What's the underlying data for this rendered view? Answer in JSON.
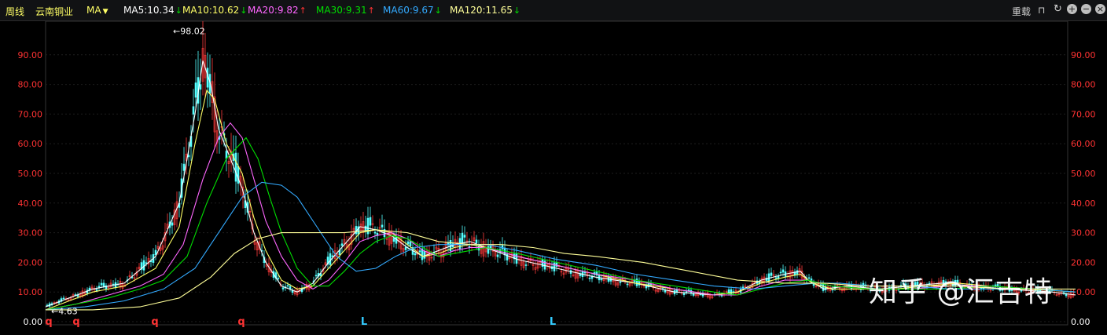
{
  "toolbar": {
    "period": "周线",
    "stock_name": "云南铜业",
    "indicator": "MA",
    "reload_label": "重载",
    "ma_items": [
      {
        "label": "MA5:10.34",
        "dir": "down",
        "color": "#ffffff"
      },
      {
        "label": "MA10:10.62",
        "dir": "down",
        "color": "#ffff66"
      },
      {
        "label": "MA20:9.82",
        "dir": "up",
        "color": "#ff66ff"
      },
      {
        "label": "MA30:9.31",
        "dir": "up",
        "color": "#00dd00"
      },
      {
        "label": "MA60:9.67",
        "dir": "down",
        "color": "#33aaff"
      },
      {
        "label": "MA120:11.65",
        "dir": "down",
        "color": "#ffff99"
      }
    ],
    "icons": [
      "lock-icon",
      "refresh-icon",
      "zoom-in-icon",
      "zoom-out-icon",
      "close-icon"
    ]
  },
  "watermark": "知乎 @汇吉特",
  "chart_data": {
    "type": "line",
    "ylim": [
      0,
      100
    ],
    "yticks": [
      "0.00",
      "10.00",
      "20.00",
      "30.00",
      "40.00",
      "50.00",
      "60.00",
      "70.00",
      "80.00",
      "90.00"
    ],
    "high_label": "←98.02",
    "low_label": "←4.63",
    "high": 98.02,
    "low": 4.63,
    "markers": [
      {
        "label": "q",
        "x": 62,
        "color": "#ff3333"
      },
      {
        "label": "q",
        "x": 97,
        "color": "#ff3333"
      },
      {
        "label": "q",
        "x": 197,
        "color": "#ff3333"
      },
      {
        "label": "q",
        "x": 307,
        "color": "#ff3333"
      },
      {
        "label": "L",
        "x": 463,
        "color": "#33ccff"
      },
      {
        "label": "L",
        "x": 703,
        "color": "#33ccff"
      }
    ],
    "series": [
      {
        "color": "#ffffff",
        "points": [
          [
            0,
            5
          ],
          [
            30,
            8
          ],
          [
            60,
            11
          ],
          [
            100,
            13
          ],
          [
            140,
            22
          ],
          [
            170,
            40
          ],
          [
            190,
            70
          ],
          [
            200,
            88
          ],
          [
            210,
            80
          ],
          [
            220,
            65
          ],
          [
            235,
            55
          ],
          [
            250,
            45
          ],
          [
            265,
            30
          ],
          [
            280,
            20
          ],
          [
            300,
            12
          ],
          [
            320,
            10
          ],
          [
            340,
            13
          ],
          [
            360,
            20
          ],
          [
            380,
            26
          ],
          [
            400,
            32
          ],
          [
            420,
            31
          ],
          [
            440,
            29
          ],
          [
            460,
            25
          ],
          [
            480,
            22
          ],
          [
            500,
            24
          ],
          [
            520,
            26
          ],
          [
            540,
            27
          ],
          [
            560,
            25
          ],
          [
            600,
            21
          ],
          [
            650,
            18
          ],
          [
            700,
            15
          ],
          [
            750,
            13
          ],
          [
            800,
            10
          ],
          [
            850,
            9
          ],
          [
            880,
            10
          ],
          [
            910,
            14
          ],
          [
            940,
            16
          ],
          [
            960,
            17
          ],
          [
            970,
            14
          ],
          [
            990,
            11
          ],
          [
            1020,
            12
          ],
          [
            1060,
            11
          ],
          [
            1100,
            12
          ],
          [
            1140,
            13
          ],
          [
            1180,
            12
          ],
          [
            1220,
            11
          ],
          [
            1280,
            10
          ],
          [
            1310,
            9
          ]
        ]
      },
      {
        "color": "#ffff66",
        "points": [
          [
            0,
            4
          ],
          [
            30,
            7
          ],
          [
            60,
            10
          ],
          [
            100,
            12
          ],
          [
            140,
            18
          ],
          [
            170,
            32
          ],
          [
            190,
            60
          ],
          [
            205,
            78
          ],
          [
            215,
            75
          ],
          [
            230,
            60
          ],
          [
            250,
            50
          ],
          [
            265,
            35
          ],
          [
            280,
            24
          ],
          [
            300,
            14
          ],
          [
            320,
            11
          ],
          [
            340,
            12
          ],
          [
            360,
            18
          ],
          [
            380,
            24
          ],
          [
            400,
            30
          ],
          [
            420,
            31
          ],
          [
            440,
            30
          ],
          [
            460,
            26
          ],
          [
            480,
            22
          ],
          [
            500,
            23
          ],
          [
            520,
            25
          ],
          [
            540,
            26
          ],
          [
            560,
            25
          ],
          [
            600,
            22
          ],
          [
            650,
            19
          ],
          [
            700,
            16
          ],
          [
            750,
            13
          ],
          [
            800,
            11
          ],
          [
            850,
            9
          ],
          [
            880,
            10
          ],
          [
            910,
            13
          ],
          [
            940,
            15
          ],
          [
            960,
            16
          ],
          [
            975,
            13
          ],
          [
            1000,
            11
          ],
          [
            1040,
            11
          ],
          [
            1080,
            11
          ],
          [
            1120,
            12
          ],
          [
            1160,
            13
          ],
          [
            1200,
            12
          ],
          [
            1250,
            11
          ],
          [
            1310,
            10
          ]
        ]
      },
      {
        "color": "#ff66ff",
        "points": [
          [
            0,
            4
          ],
          [
            40,
            6
          ],
          [
            80,
            9
          ],
          [
            120,
            12
          ],
          [
            150,
            16
          ],
          [
            175,
            26
          ],
          [
            200,
            48
          ],
          [
            220,
            62
          ],
          [
            235,
            67
          ],
          [
            250,
            62
          ],
          [
            265,
            48
          ],
          [
            280,
            34
          ],
          [
            300,
            22
          ],
          [
            320,
            14
          ],
          [
            340,
            11
          ],
          [
            360,
            14
          ],
          [
            380,
            20
          ],
          [
            400,
            27
          ],
          [
            420,
            29
          ],
          [
            440,
            30
          ],
          [
            460,
            28
          ],
          [
            480,
            24
          ],
          [
            500,
            22
          ],
          [
            520,
            24
          ],
          [
            540,
            25
          ],
          [
            560,
            25
          ],
          [
            600,
            22
          ],
          [
            650,
            19
          ],
          [
            700,
            16
          ],
          [
            750,
            14
          ],
          [
            800,
            11
          ],
          [
            850,
            9
          ],
          [
            880,
            9
          ],
          [
            910,
            12
          ],
          [
            940,
            14
          ],
          [
            970,
            14
          ],
          [
            1000,
            12
          ],
          [
            1050,
            11
          ],
          [
            1100,
            11
          ],
          [
            1150,
            12
          ],
          [
            1200,
            12
          ],
          [
            1260,
            11
          ],
          [
            1310,
            10
          ]
        ]
      },
      {
        "color": "#00dd00",
        "points": [
          [
            0,
            4
          ],
          [
            40,
            6
          ],
          [
            80,
            8
          ],
          [
            120,
            11
          ],
          [
            150,
            14
          ],
          [
            180,
            22
          ],
          [
            205,
            40
          ],
          [
            230,
            55
          ],
          [
            255,
            62
          ],
          [
            270,
            55
          ],
          [
            285,
            42
          ],
          [
            300,
            30
          ],
          [
            320,
            18
          ],
          [
            340,
            12
          ],
          [
            360,
            12
          ],
          [
            380,
            17
          ],
          [
            400,
            23
          ],
          [
            420,
            27
          ],
          [
            440,
            29
          ],
          [
            460,
            28
          ],
          [
            480,
            25
          ],
          [
            500,
            22
          ],
          [
            520,
            23
          ],
          [
            540,
            24
          ],
          [
            560,
            25
          ],
          [
            600,
            23
          ],
          [
            650,
            20
          ],
          [
            700,
            17
          ],
          [
            750,
            14
          ],
          [
            800,
            12
          ],
          [
            850,
            10
          ],
          [
            880,
            9
          ],
          [
            910,
            11
          ],
          [
            940,
            13
          ],
          [
            970,
            14
          ],
          [
            1000,
            12
          ],
          [
            1050,
            11
          ],
          [
            1100,
            11
          ],
          [
            1150,
            11
          ],
          [
            1200,
            12
          ],
          [
            1260,
            11
          ],
          [
            1310,
            10
          ]
        ]
      },
      {
        "color": "#33aaff",
        "points": [
          [
            0,
            4
          ],
          [
            50,
            5
          ],
          [
            100,
            7
          ],
          [
            150,
            11
          ],
          [
            190,
            18
          ],
          [
            220,
            30
          ],
          [
            250,
            42
          ],
          [
            275,
            47
          ],
          [
            300,
            46
          ],
          [
            320,
            42
          ],
          [
            345,
            32
          ],
          [
            370,
            22
          ],
          [
            395,
            17
          ],
          [
            420,
            18
          ],
          [
            445,
            22
          ],
          [
            470,
            25
          ],
          [
            500,
            26
          ],
          [
            530,
            26
          ],
          [
            560,
            26
          ],
          [
            600,
            24
          ],
          [
            650,
            21
          ],
          [
            700,
            19
          ],
          [
            750,
            16
          ],
          [
            800,
            14
          ],
          [
            850,
            12
          ],
          [
            900,
            11
          ],
          [
            940,
            12
          ],
          [
            980,
            13
          ],
          [
            1010,
            13
          ],
          [
            1050,
            12
          ],
          [
            1100,
            12
          ],
          [
            1150,
            11
          ],
          [
            1200,
            11
          ],
          [
            1260,
            11
          ],
          [
            1310,
            10
          ]
        ]
      },
      {
        "color": "#ffff99",
        "points": [
          [
            0,
            4
          ],
          [
            60,
            4
          ],
          [
            120,
            5
          ],
          [
            170,
            8
          ],
          [
            210,
            15
          ],
          [
            240,
            23
          ],
          [
            270,
            28
          ],
          [
            300,
            30
          ],
          [
            340,
            30
          ],
          [
            380,
            30
          ],
          [
            420,
            31
          ],
          [
            460,
            30
          ],
          [
            500,
            27
          ],
          [
            540,
            26
          ],
          [
            580,
            26
          ],
          [
            620,
            25
          ],
          [
            660,
            23
          ],
          [
            700,
            22
          ],
          [
            760,
            20
          ],
          [
            820,
            17
          ],
          [
            880,
            14
          ],
          [
            940,
            13
          ],
          [
            990,
            13
          ],
          [
            1040,
            12
          ],
          [
            1100,
            12
          ],
          [
            1160,
            12
          ],
          [
            1220,
            11
          ],
          [
            1310,
            11
          ]
        ]
      }
    ]
  }
}
